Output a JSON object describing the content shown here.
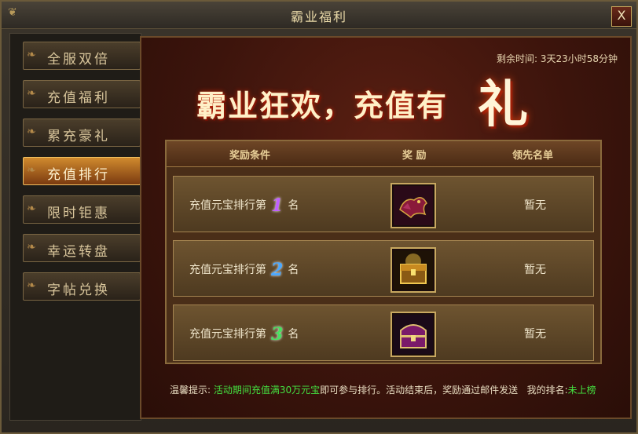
{
  "window": {
    "title": "霸业福利",
    "close_label": "X"
  },
  "sidebar": {
    "items": [
      {
        "label": "全服双倍",
        "active": false
      },
      {
        "label": "充值福利",
        "active": false
      },
      {
        "label": "累充豪礼",
        "active": false
      },
      {
        "label": "充值排行",
        "active": true
      },
      {
        "label": "限时钜惠",
        "active": false
      },
      {
        "label": "幸运转盘",
        "active": false
      },
      {
        "label": "字帖兑换",
        "active": false
      }
    ]
  },
  "main": {
    "timer_label": "剩余时间:",
    "timer_value": "3天23小时58分钟",
    "banner_text": "霸业狂欢，充值有",
    "banner_big": "礼",
    "table": {
      "headers": [
        "奖励条件",
        "奖 励",
        "领先名单"
      ],
      "rows": [
        {
          "prefix": "充值元宝排行第",
          "rank": "1",
          "suffix": "名",
          "reward_icon": "dragon-mount-icon",
          "leader": "暂无"
        },
        {
          "prefix": "充值元宝排行第",
          "rank": "2",
          "suffix": "名",
          "reward_icon": "gold-chest-icon",
          "leader": "暂无"
        },
        {
          "prefix": "充值元宝排行第",
          "rank": "3",
          "suffix": "名",
          "reward_icon": "purple-chest-icon",
          "leader": "暂无"
        }
      ]
    },
    "tip": {
      "label": "温馨提示:",
      "highlight": "活动期间充值满30万元宝",
      "rest": "即可参与排行。活动结束后，奖励通过邮件发送",
      "my_rank_label": "我的排名:",
      "my_rank_value": "未上榜"
    }
  },
  "colors": {
    "accent": "#f0c060",
    "highlight_green": "#44e040",
    "rank1": "#c060ff",
    "rank2": "#4aa8ff",
    "rank3": "#48e060"
  }
}
